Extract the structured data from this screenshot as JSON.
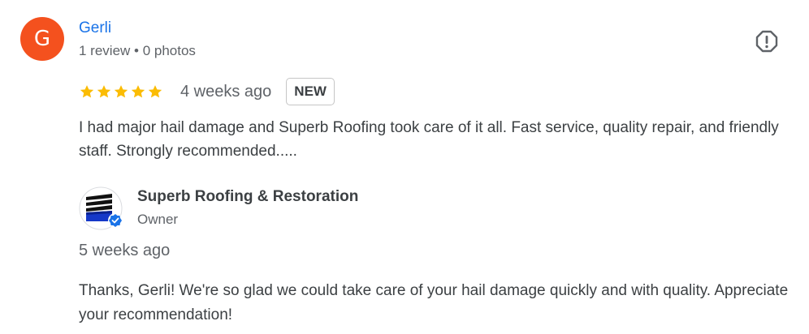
{
  "reviewer": {
    "initial": "G",
    "name": "Gerli",
    "meta": "1 review • 0 photos"
  },
  "review": {
    "rating": 5,
    "time": "4 weeks ago",
    "badge": "NEW",
    "text": "I had major hail damage and Superb Roofing took care of it all. Fast service, quality repair, and friendly staff. Strongly recommended....."
  },
  "owner_reply": {
    "name": "Superb Roofing & Restoration",
    "role": "Owner",
    "time": "5 weeks ago",
    "text": "Thanks, Gerli! We're so glad we could take care of your hail damage quickly and with quality. Appreciate your recommendation!"
  },
  "icons": {
    "flag": "report-flag-icon",
    "star": "star-icon",
    "verified": "verified-badge-icon"
  },
  "colors": {
    "avatar_bg": "#f4511e",
    "name_link": "#1a73e8",
    "star": "#fbbc04",
    "verified": "#1a73e8"
  }
}
